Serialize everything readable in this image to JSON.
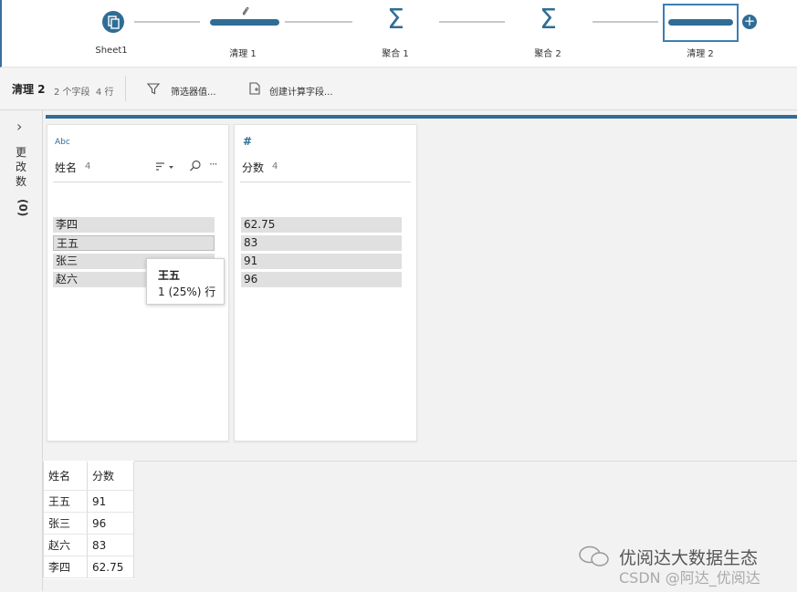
{
  "flow": {
    "nodes": [
      {
        "label": "Sheet1"
      },
      {
        "label": "清理 1"
      },
      {
        "label": "聚合 1"
      },
      {
        "label": "聚合 2"
      },
      {
        "label": "清理 2"
      }
    ],
    "sigma_glyph": "Σ",
    "add_glyph": "+"
  },
  "toolbar": {
    "step_name": "清理 2",
    "meta": "2 个字段  4 行",
    "filter_label": "筛选器值...",
    "calc_label": "创建计算字段..."
  },
  "side": {
    "chevron": "›",
    "changes_label": "更改数",
    "changes_count": "(0)"
  },
  "profile": {
    "fields": [
      {
        "type": "Abc",
        "name": "姓名",
        "count": "4",
        "values": [
          "李四",
          "王五",
          "张三",
          "赵六"
        ]
      },
      {
        "type": "#",
        "name": "分数",
        "count": "4",
        "values": [
          "62.75",
          "83",
          "91",
          "96"
        ]
      }
    ],
    "more_glyph": "···",
    "tooltip": {
      "title": "王五",
      "detail": "1 (25%) 行"
    }
  },
  "grid": {
    "headers": [
      "姓名",
      "分数"
    ],
    "rows": [
      [
        "王五",
        "91"
      ],
      [
        "张三",
        "96"
      ],
      [
        "赵六",
        "83"
      ],
      [
        "李四",
        "62.75"
      ]
    ]
  },
  "watermark": {
    "line1": "优阅达大数据生态",
    "line2": "CSDN @阿达_优阅达"
  },
  "colors": {
    "accent": "#2f6d96",
    "value_bar": "#e0e0e0"
  }
}
